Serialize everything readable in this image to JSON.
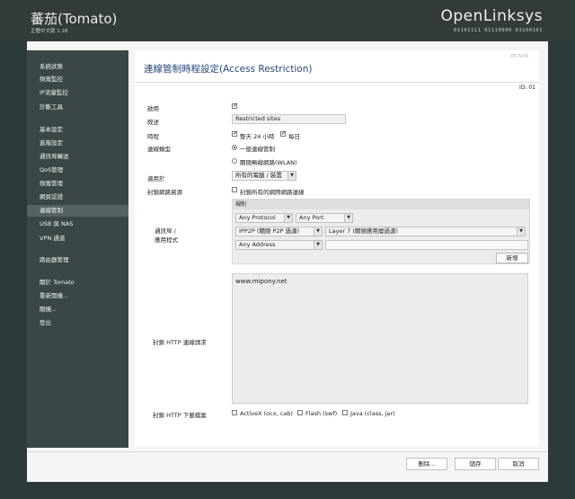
{
  "header": {
    "brand": "蕃茄(Tomato)",
    "version": "正體中文版 1.28",
    "logo": "OpenLinksys",
    "binary": "01101111 01110000 01100101"
  },
  "sidebar": {
    "items": [
      {
        "label": "系統狀態"
      },
      {
        "label": "頻寬監控"
      },
      {
        "label": "IP流量監控"
      },
      {
        "label": "診斷工具"
      },
      {
        "label": "基本設定"
      },
      {
        "label": "進階設定"
      },
      {
        "label": "通訊埠轉送"
      },
      {
        "label": "QoS管理"
      },
      {
        "label": "頻寬管理"
      },
      {
        "label": "網頁認證"
      },
      {
        "label": "連線管制"
      },
      {
        "label": "USB 與 NAS"
      },
      {
        "label": "VPN 通道"
      },
      {
        "label": "路由器管理"
      },
      {
        "label": "關於 Tomato"
      },
      {
        "label": "重新開機..."
      },
      {
        "label": "關機..."
      },
      {
        "label": "登出"
      }
    ]
  },
  "panel": {
    "model": "RT-N16",
    "title": "連線管制時程設定(Access Restriction)",
    "id_label": "ID: 01",
    "enabled_label": "啟用",
    "desc_label": "敘述",
    "desc_value": "Restricted sites",
    "schedule_label": "時程",
    "allday_label": "整天 24 小時",
    "everyday_label": "每日",
    "type_label": "連線類型",
    "type_normal": "一般連線管制",
    "type_wlan": "關閉無線網路(WLAN)",
    "applies_label": "適用於",
    "applies_value": "所有的電腦 / 裝置",
    "block_all_label": "封鎖網路資源",
    "block_all_text": "封鎖所有的網際網路連線",
    "port_app_label": "通訊埠 /\n應用程式",
    "rules_header": "規則",
    "protocol_value": "Any Protocol",
    "port_value": "Any Port",
    "ipp2p_value": "IPP2P (關閉 P2P 過濾)",
    "layer7_value": "Layer 7 (關閉應用層過濾)",
    "address_value": "Any Address",
    "add_button": "新增",
    "http_label": "封鎖 HTTP 連線請求",
    "http_value": "www.mipony.net",
    "download_label": "封鎖 HTTP 下載檔案",
    "activex": "ActiveX (ocx, cab)",
    "flash": "Flash (swf)",
    "java": "Java (class, jar)"
  },
  "footer": {
    "delete": "刪除...",
    "save": "儲存",
    "cancel": "取消"
  },
  "colors": {
    "background": "#2b3a3a",
    "sidebar": "#3b4646",
    "title": "#244878"
  }
}
